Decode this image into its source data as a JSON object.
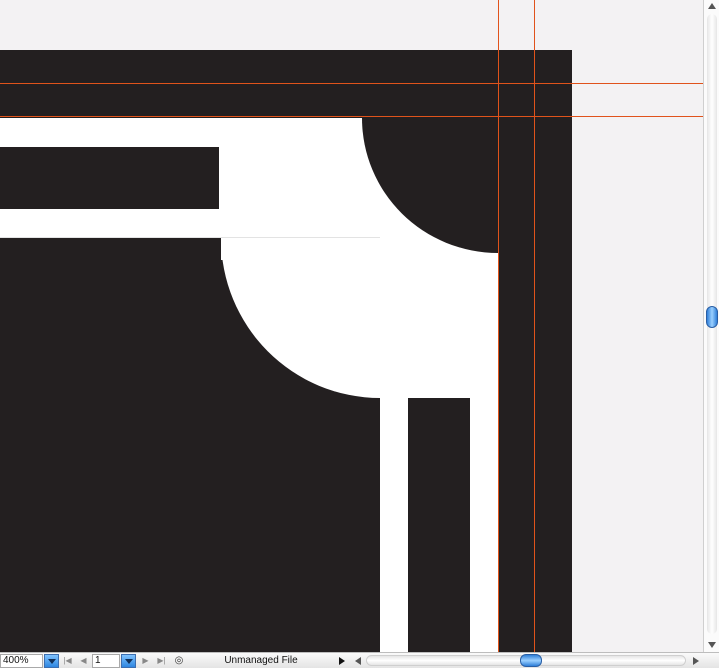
{
  "statusbar": {
    "zoom_value": "400%",
    "page_value": "1",
    "first_page_icon": "first-page-icon",
    "prev_page_icon": "previous-page-icon",
    "next_page_icon": "next-page-icon",
    "last_page_icon": "last-page-icon",
    "status_text": "Unmanaged File"
  },
  "canvas": {
    "artboard_color": "#231f20",
    "paper_color": "#ffffff",
    "guide_color": "#e0531b",
    "background_color": "#f3f2f3"
  },
  "scrollbars": {
    "accent": "#2f7fd8"
  }
}
